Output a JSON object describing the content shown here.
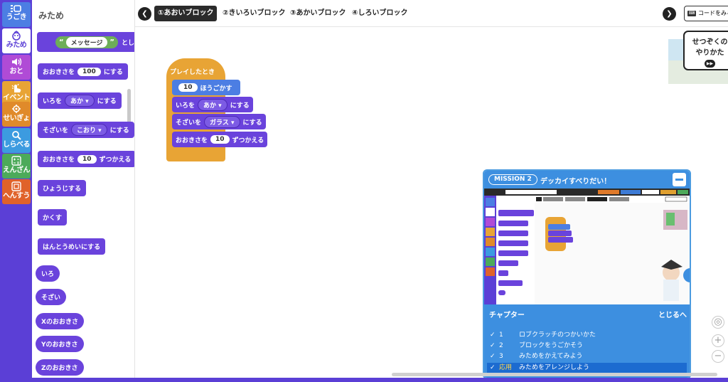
{
  "categories": [
    {
      "label": "うごき",
      "color": "#4c7ee3",
      "icon": "move-icon"
    },
    {
      "label": "みため",
      "color": "#ffffff",
      "icon": "looks-icon"
    },
    {
      "label": "おと",
      "color": "#b04bd6",
      "icon": "sound-icon"
    },
    {
      "label": "イベント",
      "color": "#e8a435",
      "icon": "event-icon"
    },
    {
      "label": "せいぎょ",
      "color": "#e08a2a",
      "icon": "control-icon"
    },
    {
      "label": "しらべる",
      "color": "#3c9be0",
      "icon": "sensing-icon"
    },
    {
      "label": "えんざん",
      "color": "#4caa5a",
      "icon": "operator-icon"
    },
    {
      "label": "へんすう",
      "color": "#e0622a",
      "icon": "variable-icon"
    }
  ],
  "palette": {
    "title": "みため",
    "blocks": {
      "say_suffix": "としゃ",
      "say_value": "メッセージ",
      "size_set_prefix": "おおきさを",
      "size_set_value": "100",
      "size_set_suffix": "にする",
      "color_set_prefix": "いろを",
      "color_set_value": "あか",
      "color_set_suffix": "にする",
      "material_set_prefix": "そざいを",
      "material_set_value": "こおり",
      "material_set_suffix": "にする",
      "size_change_prefix": "おおきさを",
      "size_change_value": "10",
      "size_change_suffix": "ずつかえる",
      "show": "ひょうじする",
      "hide": "かくす",
      "translucent": "はんとうめいにする",
      "rep_color": "いろ",
      "rep_material": "そざい",
      "rep_x_size": "Xのおおきさ",
      "rep_y_size": "Yのおおきさ",
      "rep_z_size": "Zのおおきさ"
    }
  },
  "topbar": {
    "tabs": [
      "①あおいブロック",
      "②きいろいブロック",
      "③あかいブロック",
      "④しろいブロック"
    ],
    "active_tab": 0,
    "code_button": "コードをみる"
  },
  "script": {
    "hat": "プレイしたとき",
    "move_value": "10",
    "move_suffix": "ほうごかす",
    "color_prefix": "いろを",
    "color_value": "あか",
    "color_suffix": "にする",
    "material_prefix": "そざいを",
    "material_value": "ガラス",
    "material_suffix": "にする",
    "size_prefix": "おおきさを",
    "size_value": "10",
    "size_suffix": "ずつかえる"
  },
  "explain_card": {
    "line1": "せつぞくの",
    "line2": "やりかた"
  },
  "mission": {
    "badge": "MISSION 2",
    "title": "デッカイすべりだい！",
    "chapter_title": "チャプター",
    "close_label": "とじるへ",
    "chapters": [
      {
        "num": "1",
        "title": "ロブクラッチのつかいかた",
        "done": true
      },
      {
        "num": "2",
        "title": "ブロックをうごかそう",
        "done": true
      },
      {
        "num": "3",
        "title": "みためをかえてみよう",
        "done": true
      },
      {
        "num": "応用",
        "title": "みためをアレンジしよう",
        "done": true,
        "current": true
      }
    ]
  },
  "colors": {
    "purple": "#5b3fd6",
    "looks_block": "#6a43dc",
    "motion_block": "#4c7ee3",
    "event_block": "#e8a435",
    "mission_blue": "#3d8fe0"
  }
}
